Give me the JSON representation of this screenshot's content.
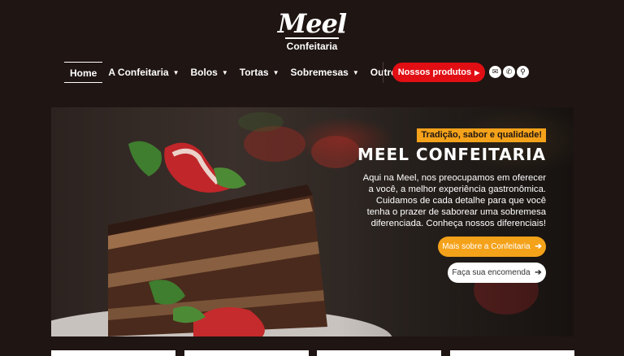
{
  "logo": {
    "script": "Meel",
    "sub": "Confeitaria"
  },
  "nav": {
    "items": [
      {
        "label": "Home",
        "caret": ""
      },
      {
        "label": "A Confeitaria",
        "caret": "▼"
      },
      {
        "label": "Bolos",
        "caret": "▼"
      },
      {
        "label": "Tortas",
        "caret": "▼"
      },
      {
        "label": "Sobremesas",
        "caret": "▼"
      },
      {
        "label": "Outros",
        "caret": "▼"
      }
    ],
    "cta_label": "Nossos produtos",
    "cta_arrow": "▶",
    "icons": [
      "envelope-icon",
      "whatsapp-icon",
      "search-icon"
    ],
    "icon_glyphs": {
      "envelope": "✉",
      "whatsapp": "✆",
      "search": "⚲"
    }
  },
  "hero": {
    "badge": "Tradição, sabor e qualidade!",
    "title": "MEEL CONFEITARIA",
    "text": "Aqui na Meel, nos preocupamos em oferecer a você, a melhor experiência gastronômica. Cuidamos de cada detalhe para que você tenha o prazer de saborear uma sobremesa diferenciada. Conheça nossos diferenciais!",
    "btn_primary": "Mais sobre a Confeitaria",
    "btn_secondary": "Faça sua encomenda",
    "btn_arrow": "➔"
  },
  "colors": {
    "background": "#1f1513",
    "accent_red": "#e10e14",
    "accent_orange": "#f4a21a"
  }
}
